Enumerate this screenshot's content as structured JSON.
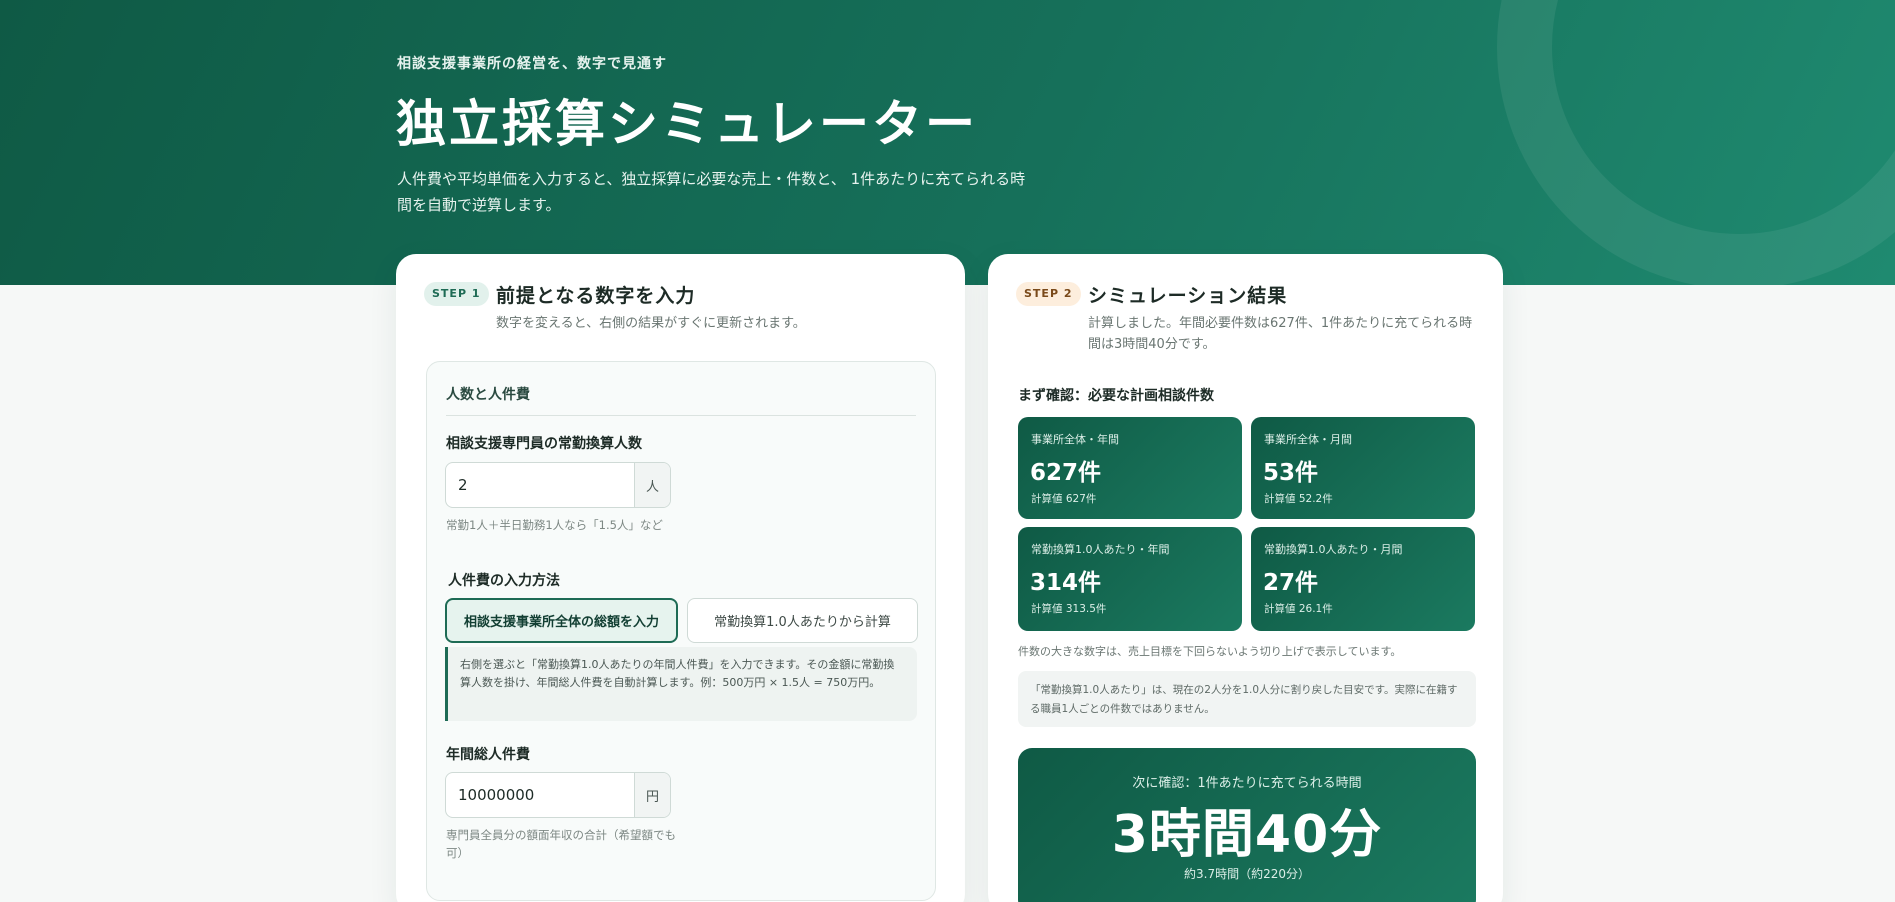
{
  "hero": {
    "eyebrow": "相談支援事業所の経営を、数字で見通す",
    "title": "独立採算シミュレーター",
    "description": "人件費や平均単価を入力すると、独立採算に必要な売上・件数と、 1件あたりに充てられる時間を自動で逆算します。"
  },
  "step1": {
    "badge": "STEP 1",
    "title": "前提となる数字を入力",
    "subtitle": "数字を変えると、右側の結果がすぐに更新されます。",
    "section_title": "人数と人件費",
    "staff": {
      "label": "相談支援専門員の常勤換算人数",
      "value": "2",
      "unit": "人",
      "hint": "常勤1人＋半日勤務1人なら「1.5人」など"
    },
    "method": {
      "label": "人件費の入力方法",
      "options": [
        "相談支援事業所全体の総額を入力",
        "常勤換算1.0人あたりから計算"
      ],
      "selected": "相談支援事業所全体の総額を入力",
      "note": "右側を選ぶと「常勤換算1.0人あたりの年間人件費」を入力できます。その金額に常勤換算人数を掛け、年間総人件費を自動計算します。例：500万円 × 1.5人 = 750万円。"
    },
    "payroll": {
      "label": "年間総人件費",
      "value": "10000000",
      "unit": "円",
      "hint": "専門員全員分の額面年収の合計（希望額でも可）"
    }
  },
  "step2": {
    "badge": "STEP 2",
    "title": "シミュレーション結果",
    "subtitle": "計算しました。年間必要件数は627件、1件あたりに充てられる時間は3時間40分です。",
    "cases_heading": "まず確認：必要な計画相談件数",
    "metrics": [
      {
        "label": "事業所全体・年間",
        "value": "627件",
        "sub": "計算値 627件"
      },
      {
        "label": "事業所全体・月間",
        "value": "53件",
        "sub": "計算値 52.2件"
      },
      {
        "label": "常勤換算1.0人あたり・年間",
        "value": "314件",
        "sub": "計算値 313.5件"
      },
      {
        "label": "常勤換算1.0人あたり・月間",
        "value": "27件",
        "sub": "計算値 26.1件"
      }
    ],
    "rounding_note": "件数の大きな数字は、売上目標を下回らないよう切り上げで表示しています。",
    "per_fte_note": "「常勤換算1.0人あたり」は、現在の2人分を1.0人分に割り戻した目安です。実際に在籍する職員1人ごとの件数ではありません。",
    "time": {
      "label": "次に確認：1件あたりに充てられる時間",
      "value": "3時間40分",
      "sub": "約3.7時間（約220分）"
    }
  },
  "colors": {
    "brand": "#0f5a45",
    "accent": "#1b7a60",
    "step2_badge": "#fdeedd"
  }
}
